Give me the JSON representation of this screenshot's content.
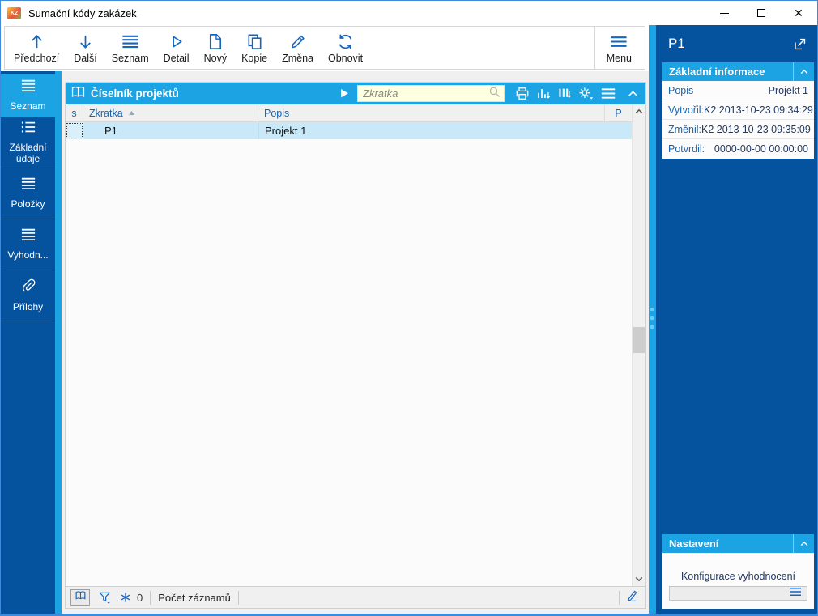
{
  "colors": {
    "accent_cyan": "#1BA3E4",
    "panel_dark_blue": "#05529E",
    "window_border_blue": "#3D8BDD",
    "selected_row": "#C9E9F8",
    "label_blue": "#1464B4",
    "value_navy": "#203864",
    "search_field_bg": "#FFFFE1",
    "toolbar_icon_blue": "#1565C0"
  },
  "window": {
    "title": "Sumační kódy zakázek",
    "logo_text": "K2"
  },
  "toolbar": {
    "buttons": [
      {
        "label": "Předchozí",
        "icon": "arrow-up-icon"
      },
      {
        "label": "Další",
        "icon": "arrow-down-icon"
      },
      {
        "label": "Seznam",
        "icon": "list-icon"
      },
      {
        "label": "Detail",
        "icon": "play-outline-icon"
      },
      {
        "label": "Nový",
        "icon": "document-icon"
      },
      {
        "label": "Kopie",
        "icon": "copy-icon"
      },
      {
        "label": "Změna",
        "icon": "pencil-icon"
      },
      {
        "label": "Obnovit",
        "icon": "refresh-icon"
      }
    ],
    "menu_label": "Menu"
  },
  "sidebar": {
    "items": [
      {
        "label": "Seznam",
        "icon": "list-icon",
        "active": true
      },
      {
        "label": "Základní údaje",
        "icon": "detail-list-icon",
        "active": false
      },
      {
        "label": "Položky",
        "icon": "list-icon",
        "active": false
      },
      {
        "label": "Vyhodn...",
        "icon": "list-icon",
        "active": false
      },
      {
        "label": "Přílohy",
        "icon": "paperclip-icon",
        "active": false
      }
    ]
  },
  "grid": {
    "title": "Číselník projektů",
    "search": {
      "placeholder": "Zkratka",
      "value": ""
    },
    "columns": {
      "s": "s",
      "zkratka": "Zkratka",
      "popis": "Popis",
      "p": "P"
    },
    "sort": {
      "column": "Zkratka",
      "direction": "asc"
    },
    "rows": [
      {
        "zkratka": "P1",
        "popis": "Projekt 1"
      }
    ],
    "footer": {
      "filter_count": "0",
      "records_label": "Počet záznamů"
    }
  },
  "right_panel": {
    "title": "P1",
    "basic_info": {
      "title": "Základní informace",
      "rows": [
        {
          "label": "Popis",
          "value": "Projekt 1"
        },
        {
          "label": "Vytvořil:",
          "value": "K2 2013-10-23 09:34:29"
        },
        {
          "label": "Změnil:",
          "value": "K2 2013-10-23 09:35:09"
        },
        {
          "label": "Potvrdil:",
          "value": "0000-00-00 00:00:00"
        }
      ]
    },
    "settings": {
      "title": "Nastavení",
      "field_label": "Konfigurace vyhodnocení",
      "field_value": ""
    }
  }
}
